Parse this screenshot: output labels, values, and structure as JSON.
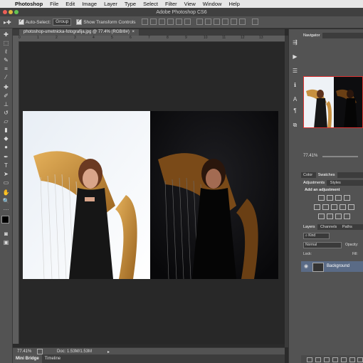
{
  "menubar": {
    "apple": "",
    "app": "Photoshop",
    "items": [
      "File",
      "Edit",
      "Image",
      "Layer",
      "Type",
      "Select",
      "Filter",
      "View",
      "Window",
      "Help"
    ]
  },
  "window": {
    "title": "Adobe Photoshop CS6"
  },
  "options": {
    "auto_select_label": "Auto-Select:",
    "auto_select_value": "Group",
    "transform_label": "Show Transform Controls"
  },
  "document": {
    "tab_label": "photoshop-umetnicka-fotografija.jpg @ 77.4% (RGB/8#)",
    "ruler_ticks": [
      "0",
      "1",
      "2",
      "3",
      "4",
      "5",
      "6",
      "7",
      "8",
      "9",
      "10",
      "11",
      "12",
      "13"
    ]
  },
  "status": {
    "zoom": "77.41%",
    "doc_info": "Doc: 1.53M/1.53M"
  },
  "bottom_tabs": [
    "Mini Bridge",
    "Timeline"
  ],
  "panels": {
    "navigator_title": "Navigator",
    "nav_zoom": "77.41%",
    "color_tabs": [
      "Color",
      "Swatches"
    ],
    "adj_tabs": [
      "Adjustments",
      "Styles"
    ],
    "add_adjustment": "Add an adjustment",
    "layer_tabs": [
      "Layers",
      "Channels",
      "Paths"
    ],
    "kind_label": "Kind",
    "blend_mode": "Normal",
    "opacity_label": "Opacity:",
    "lock_label": "Lock:",
    "fill_label": "Fill:",
    "layer_name": "Background"
  },
  "colors": {
    "accent_layer": "#5a6b86",
    "nav_frame": "#dd3333"
  }
}
